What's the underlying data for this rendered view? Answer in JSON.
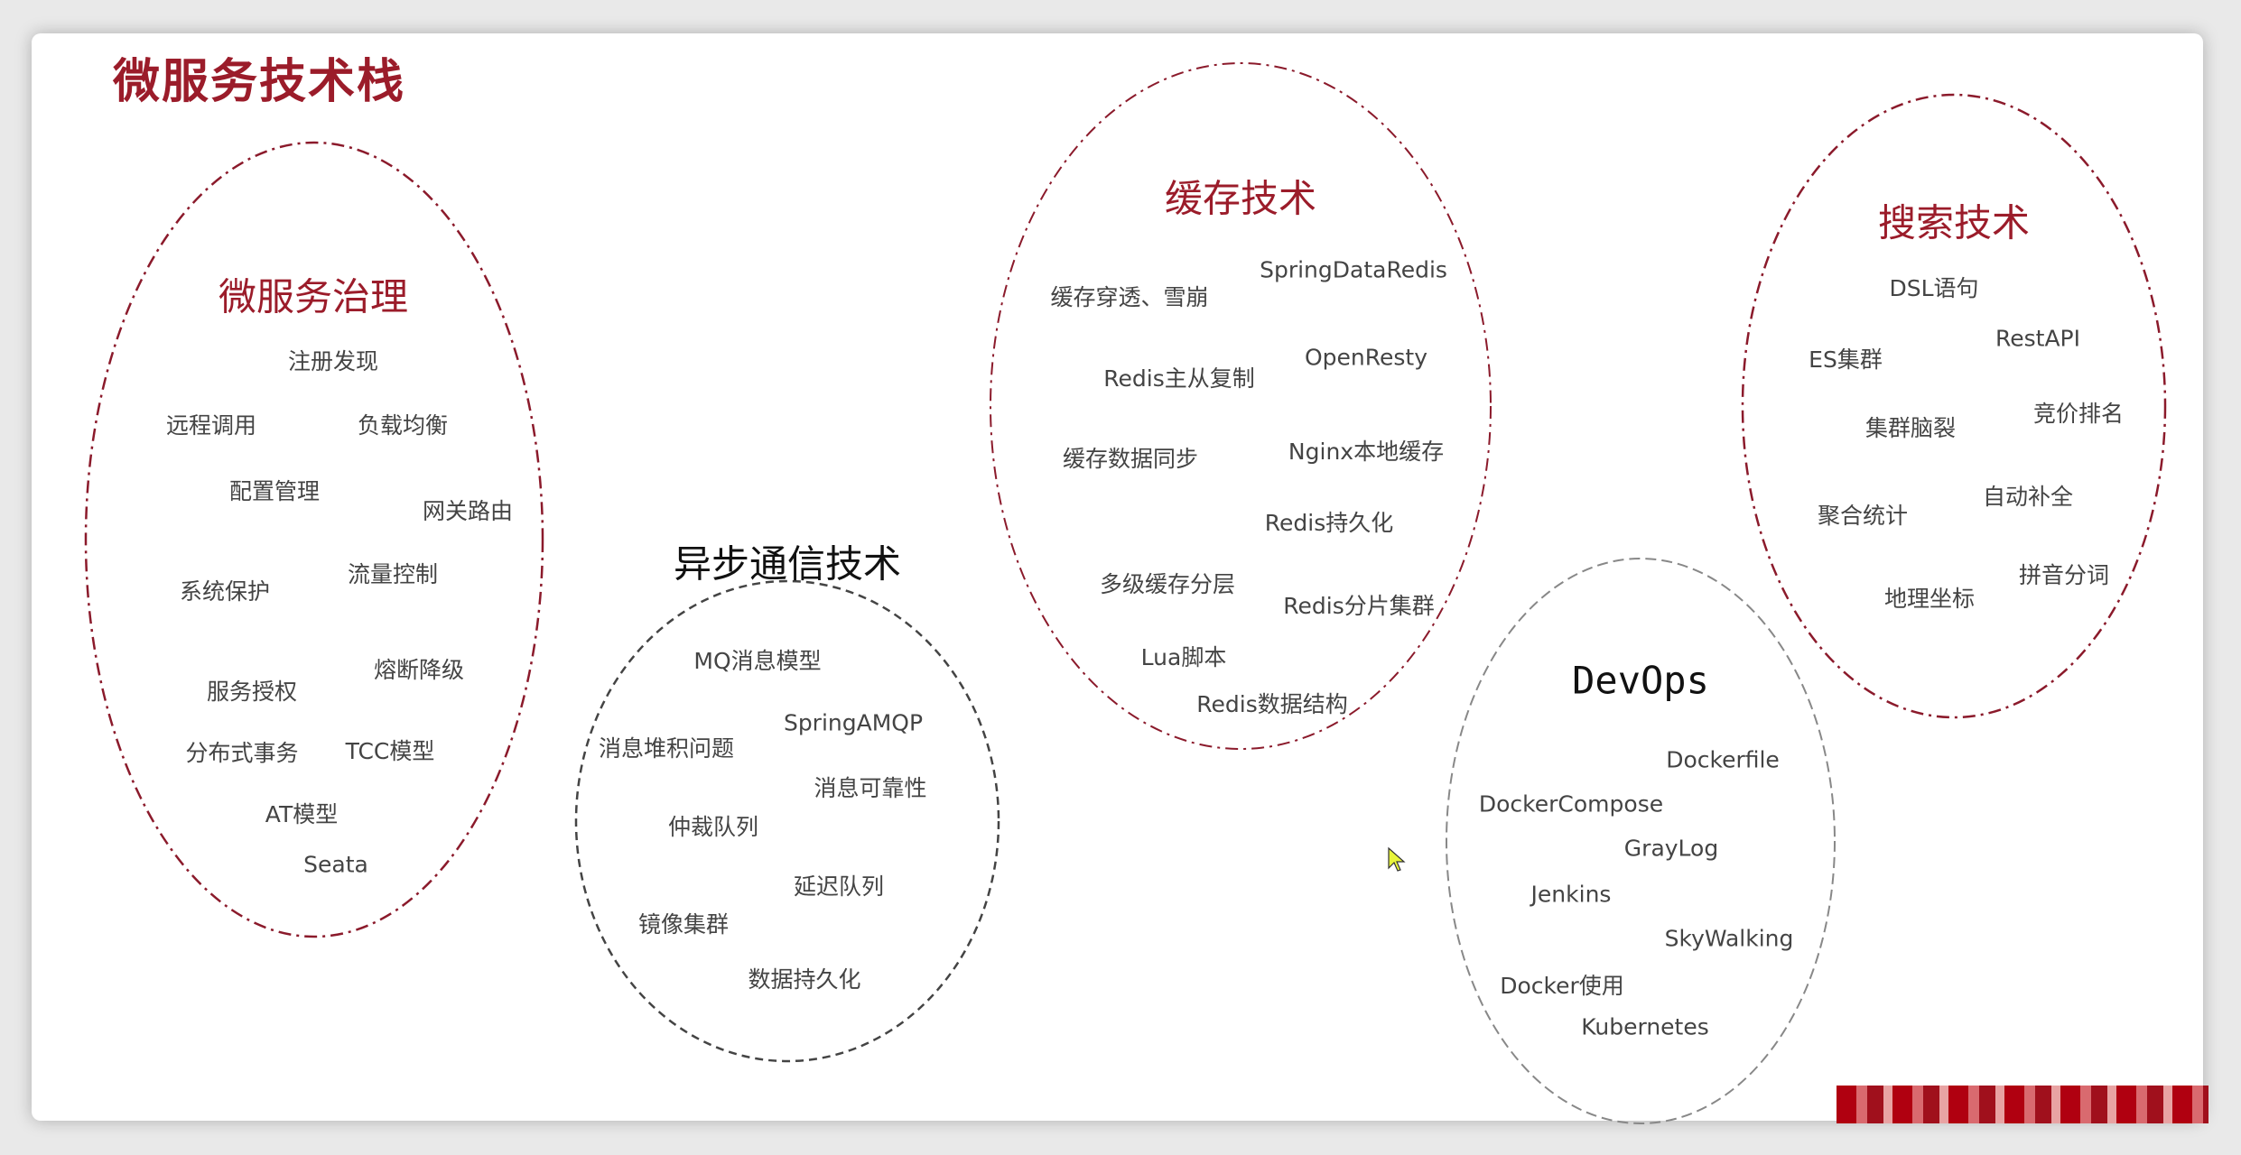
{
  "title": "微服务技术栈",
  "groups": [
    {
      "title": "微服务治理",
      "items": [
        "注册发现",
        "远程调用",
        "负载均衡",
        "配置管理",
        "网关路由",
        "系统保护",
        "流量控制",
        "熔断降级",
        "服务授权",
        "分布式事务",
        "TCC模型",
        "AT模型",
        "Seata"
      ]
    },
    {
      "title": "异步通信技术",
      "items": [
        "MQ消息模型",
        "SpringAMQP",
        "消息堆积问题",
        "消息可靠性",
        "仲裁队列",
        "延迟队列",
        "镜像集群",
        "数据持久化"
      ]
    },
    {
      "title": "缓存技术",
      "items": [
        "缓存穿透、雪崩",
        "SpringDataRedis",
        "Redis主从复制",
        "OpenResty",
        "缓存数据同步",
        "Nginx本地缓存",
        "Redis持久化",
        "多级缓存分层",
        "Redis分片集群",
        "Lua脚本",
        "Redis数据结构"
      ]
    },
    {
      "title": "搜索技术",
      "items": [
        "DSL语句",
        "RestAPI",
        "ES集群",
        "集群脑裂",
        "竞价排名",
        "聚合统计",
        "自动补全",
        "拼音分词",
        "地理坐标"
      ]
    },
    {
      "title": "DevOps",
      "items": [
        "Dockerfile",
        "DockerCompose",
        "GrayLog",
        "Jenkins",
        "SkyWalking",
        "Docker使用",
        "Kubernetes"
      ]
    }
  ],
  "colors": {
    "accent": "#9b1c2a",
    "ring_dark": "#444444",
    "ring_light": "#888888",
    "text": "#444444"
  }
}
